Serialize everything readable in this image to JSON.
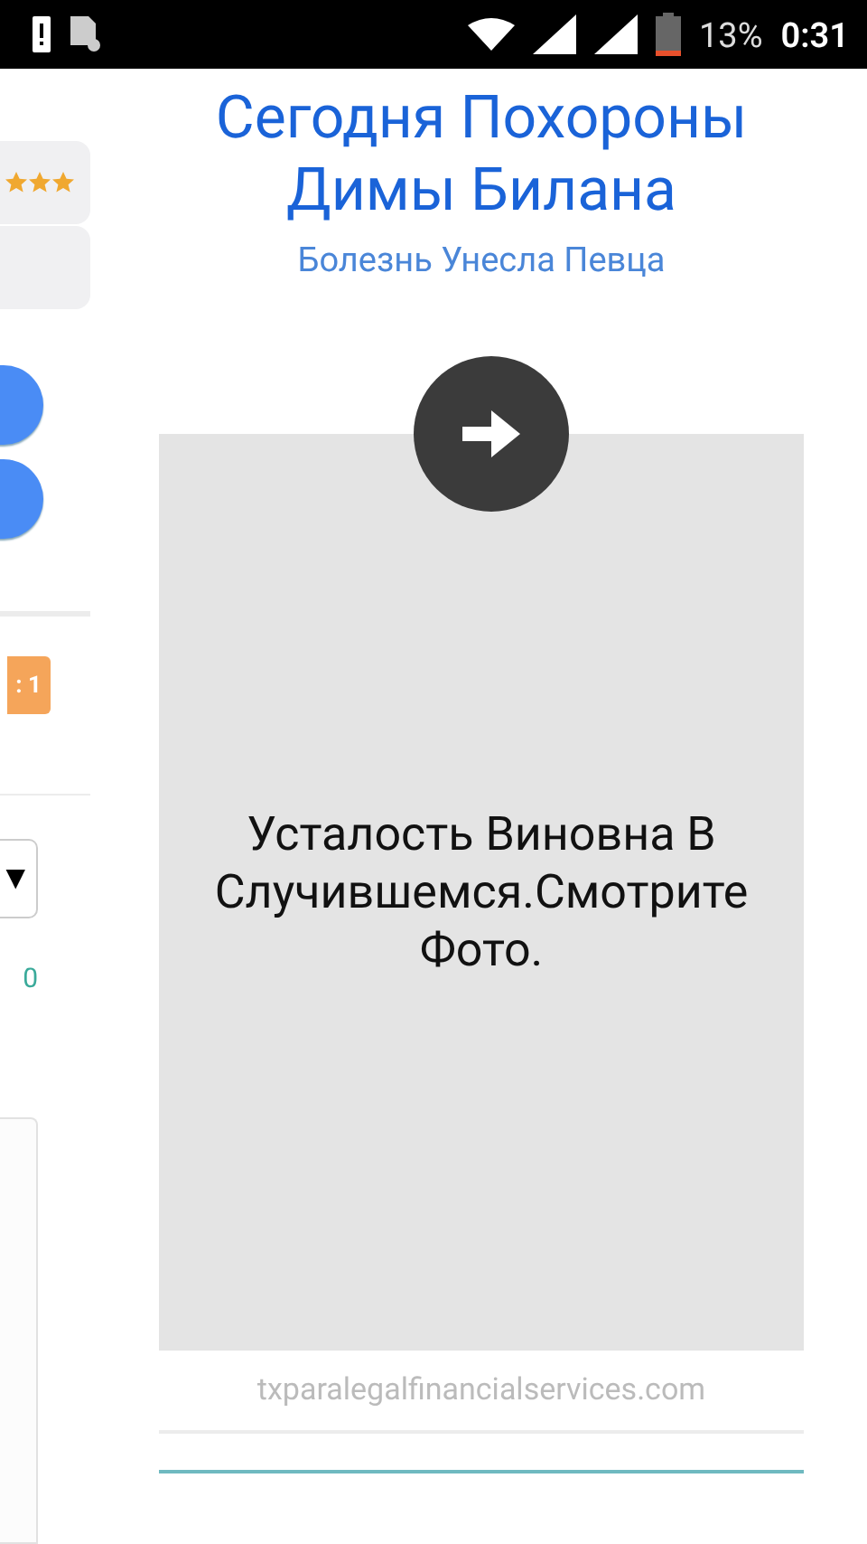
{
  "status_bar": {
    "battery": "13%",
    "time": "0:31"
  },
  "side_panel": {
    "rating": {
      "stars": 3
    },
    "badge": ": 1",
    "dropdown_arrow": "▼",
    "counter": "0"
  },
  "ad": {
    "title": "Сегодня Похороны Димы Билана",
    "subtitle": "Болезнь Унесла Певца",
    "body": "Усталость Виновна В Случившемся.Смотрите Фото.",
    "domain": "txparalegalfinancialservices.com"
  }
}
